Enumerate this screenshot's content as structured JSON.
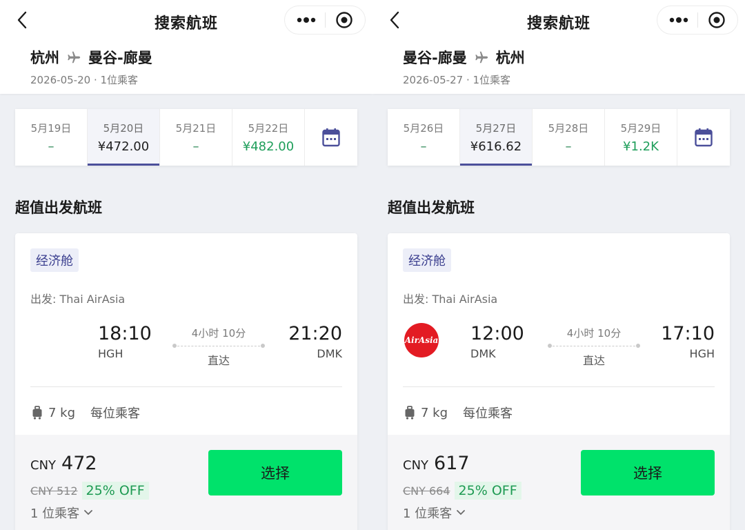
{
  "page_title": "搜索航班",
  "colors": {
    "accent_indigo": "#4b4f9a",
    "price_green": "#1e9e5a",
    "select_green": "#00e26b",
    "airasia_red": "#e31b23"
  },
  "panels": [
    {
      "header": {
        "from": "杭州",
        "to": "曼谷-廊曼",
        "date": "2026-05-20",
        "passengers": "1位乘客"
      },
      "dates": [
        {
          "date": "5月19日",
          "price": "–"
        },
        {
          "date": "5月20日",
          "price": "¥472.00",
          "selected": true
        },
        {
          "date": "5月21日",
          "price": "–"
        },
        {
          "date": "5月22日",
          "price": "¥482.00"
        }
      ],
      "section_title": "超值出发航班",
      "flight": {
        "cabin": "经济舱",
        "operator": "出发: Thai AirAsia",
        "dep_time": "18:10",
        "dep_code": "HGH",
        "duration": "4小时 10分",
        "stops": "直达",
        "arr_time": "21:20",
        "arr_code": "DMK",
        "baggage": "7 kg",
        "baggage_per": "每位乘客",
        "currency": "CNY",
        "price": "472",
        "old_price": "CNY 512",
        "discount": "25% OFF",
        "pax": "1 位乘客",
        "select_label": "选择",
        "show_logo": false
      }
    },
    {
      "header": {
        "from": "曼谷-廊曼",
        "to": "杭州",
        "date": "2026-05-27",
        "passengers": "1位乘客"
      },
      "dates": [
        {
          "date": "5月26日",
          "price": "–"
        },
        {
          "date": "5月27日",
          "price": "¥616.62",
          "selected": true
        },
        {
          "date": "5月28日",
          "price": "–"
        },
        {
          "date": "5月29日",
          "price": "¥1.2K"
        }
      ],
      "section_title": "超值出发航班",
      "flight": {
        "cabin": "经济舱",
        "operator": "出发: Thai AirAsia",
        "logo_text": "AirAsia",
        "dep_time": "12:00",
        "dep_code": "DMK",
        "duration": "4小时 10分",
        "stops": "直达",
        "arr_time": "17:10",
        "arr_code": "HGH",
        "baggage": "7 kg",
        "baggage_per": "每位乘客",
        "currency": "CNY",
        "price": "617",
        "old_price": "CNY 664",
        "discount": "25% OFF",
        "pax": "1 位乘客",
        "select_label": "选择",
        "show_logo": true
      }
    }
  ]
}
